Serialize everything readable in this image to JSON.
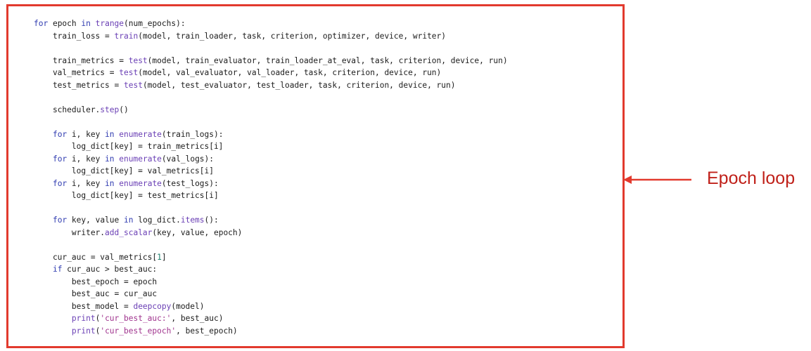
{
  "annotation": {
    "label": "Epoch loop",
    "color": "#c0211a",
    "frame_color": "#e23a2e"
  },
  "code": {
    "lines": [
      [
        {
          "t": "for",
          "c": "kw"
        },
        {
          "t": " epoch "
        },
        {
          "t": "in",
          "c": "kw"
        },
        {
          "t": " "
        },
        {
          "t": "trange",
          "c": "fn"
        },
        {
          "t": "(num_epochs):"
        }
      ],
      [
        {
          "t": "    train_loss = "
        },
        {
          "t": "train",
          "c": "fn"
        },
        {
          "t": "(model, train_loader, task, criterion, optimizer, device, writer)"
        }
      ],
      [],
      [
        {
          "t": "    train_metrics = "
        },
        {
          "t": "test",
          "c": "fn"
        },
        {
          "t": "(model, train_evaluator, train_loader_at_eval, task, criterion, device, run)"
        }
      ],
      [
        {
          "t": "    val_metrics = "
        },
        {
          "t": "test",
          "c": "fn"
        },
        {
          "t": "(model, val_evaluator, val_loader, task, criterion, device, run)"
        }
      ],
      [
        {
          "t": "    test_metrics = "
        },
        {
          "t": "test",
          "c": "fn"
        },
        {
          "t": "(model, test_evaluator, test_loader, task, criterion, device, run)"
        }
      ],
      [],
      [
        {
          "t": "    scheduler."
        },
        {
          "t": "step",
          "c": "fn"
        },
        {
          "t": "()"
        }
      ],
      [],
      [
        {
          "t": "    "
        },
        {
          "t": "for",
          "c": "kw"
        },
        {
          "t": " i, key "
        },
        {
          "t": "in",
          "c": "kw"
        },
        {
          "t": " "
        },
        {
          "t": "enumerate",
          "c": "fn"
        },
        {
          "t": "(train_logs):"
        }
      ],
      [
        {
          "t": "        log_dict[key] = train_metrics[i]"
        }
      ],
      [
        {
          "t": "    "
        },
        {
          "t": "for",
          "c": "kw"
        },
        {
          "t": " i, key "
        },
        {
          "t": "in",
          "c": "kw"
        },
        {
          "t": " "
        },
        {
          "t": "enumerate",
          "c": "fn"
        },
        {
          "t": "(val_logs):"
        }
      ],
      [
        {
          "t": "        log_dict[key] = val_metrics[i]"
        }
      ],
      [
        {
          "t": "    "
        },
        {
          "t": "for",
          "c": "kw"
        },
        {
          "t": " i, key "
        },
        {
          "t": "in",
          "c": "kw"
        },
        {
          "t": " "
        },
        {
          "t": "enumerate",
          "c": "fn"
        },
        {
          "t": "(test_logs):"
        }
      ],
      [
        {
          "t": "        log_dict[key] = test_metrics[i]"
        }
      ],
      [],
      [
        {
          "t": "    "
        },
        {
          "t": "for",
          "c": "kw"
        },
        {
          "t": " key, value "
        },
        {
          "t": "in",
          "c": "kw"
        },
        {
          "t": " log_dict."
        },
        {
          "t": "items",
          "c": "fn"
        },
        {
          "t": "():"
        }
      ],
      [
        {
          "t": "        writer."
        },
        {
          "t": "add_scalar",
          "c": "fn"
        },
        {
          "t": "(key, value, epoch)"
        }
      ],
      [],
      [
        {
          "t": "    cur_auc = val_metrics["
        },
        {
          "t": "1",
          "c": "num"
        },
        {
          "t": "]"
        }
      ],
      [
        {
          "t": "    "
        },
        {
          "t": "if",
          "c": "kw"
        },
        {
          "t": " cur_auc > best_auc:"
        }
      ],
      [
        {
          "t": "        best_epoch = epoch"
        }
      ],
      [
        {
          "t": "        best_auc = cur_auc"
        }
      ],
      [
        {
          "t": "        best_model = "
        },
        {
          "t": "deepcopy",
          "c": "fn"
        },
        {
          "t": "(model)"
        }
      ],
      [
        {
          "t": "        "
        },
        {
          "t": "print",
          "c": "fn"
        },
        {
          "t": "("
        },
        {
          "t": "'cur_best_auc:'",
          "c": "str"
        },
        {
          "t": ", best_auc)"
        }
      ],
      [
        {
          "t": "        "
        },
        {
          "t": "print",
          "c": "fn"
        },
        {
          "t": "("
        },
        {
          "t": "'cur_best_epoch'",
          "c": "str"
        },
        {
          "t": ", best_epoch)"
        }
      ]
    ]
  }
}
